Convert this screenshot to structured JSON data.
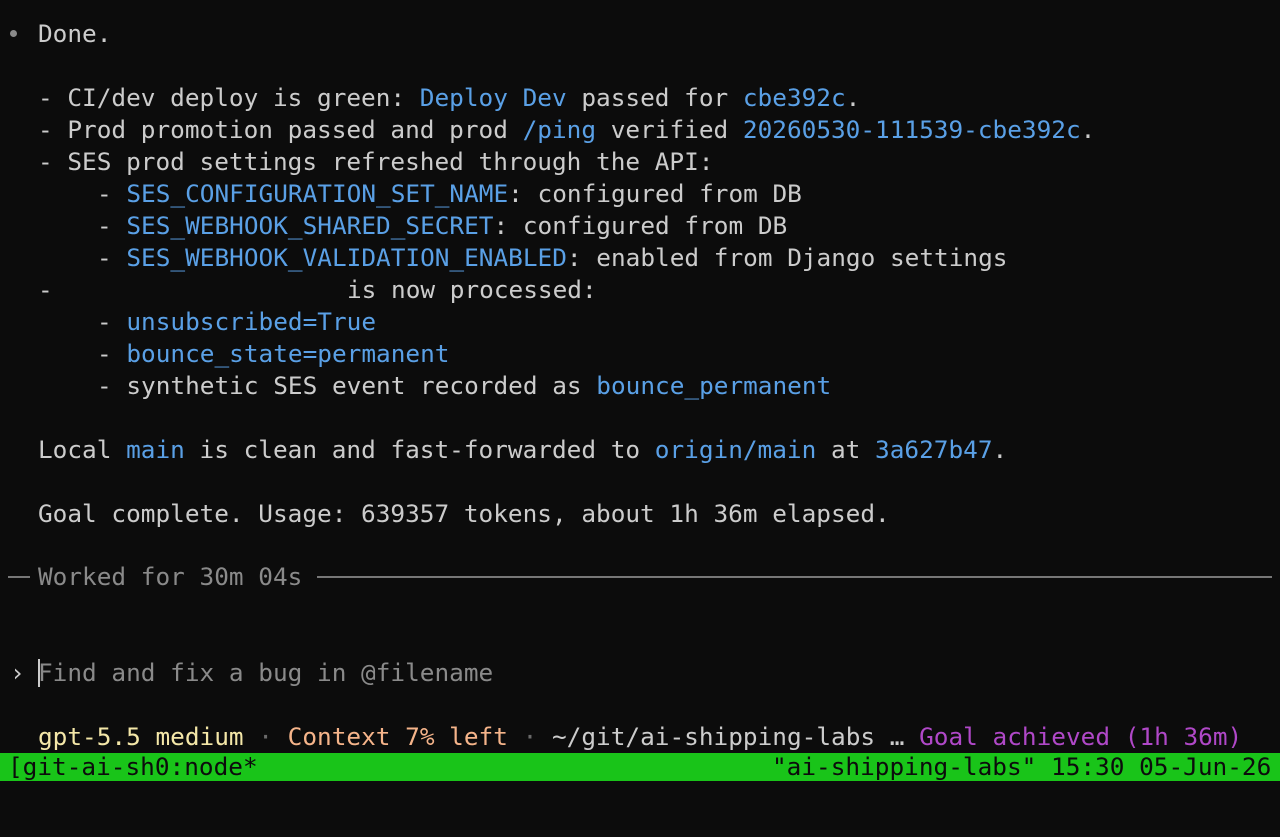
{
  "transcript": {
    "done": "Done.",
    "l1": {
      "pre": "- CI/dev deploy is green: ",
      "h1": "Deploy Dev",
      "mid": " passed for ",
      "h2": "cbe392c",
      "post": "."
    },
    "l2": {
      "pre": "- Prod promotion passed and prod ",
      "h1": "/ping",
      "mid": " verified ",
      "h2": "20260530-111539-cbe392c",
      "post": "."
    },
    "l3": "- SES prod settings refreshed through the API:",
    "l4": {
      "pre": "- ",
      "h": "SES_CONFIGURATION_SET_NAME",
      "post": ": configured from DB"
    },
    "l5": {
      "pre": "- ",
      "h": "SES_WEBHOOK_SHARED_SECRET",
      "post": ": configured from DB"
    },
    "l6": {
      "pre": "- ",
      "h": "SES_WEBHOOK_VALIDATION_ENABLED",
      "post": ": enabled from Django settings"
    },
    "l7a": "-",
    "l7b": "is now processed:",
    "l8": {
      "pre": "- ",
      "h": "unsubscribed=True"
    },
    "l9": {
      "pre": "- ",
      "h": "bounce_state=permanent"
    },
    "l10": {
      "pre": "- synthetic SES event recorded as ",
      "h": "bounce_permanent"
    },
    "l11": {
      "pre": "Local ",
      "h1": "main",
      "mid": " is clean and fast-forwarded to ",
      "h2": "origin/main",
      "mid2": " at ",
      "h3": "3a627b47",
      "post": "."
    },
    "l12": "Goal complete. Usage: 639357 tokens, about 1h 36m elapsed.",
    "worked": "Worked for 30m 04s"
  },
  "prompt": {
    "chevron": "›",
    "placeholder": "Find and fix a bug in @filename"
  },
  "footer": {
    "model": "gpt-5.5 medium",
    "sep1": " · ",
    "context": "Context 7% left",
    "sep2": " · ",
    "path": "~/git/ai-shipping-labs …",
    "goal": "Goal achieved (1h 36m)"
  },
  "statusbar": {
    "left": "[git-ai-sh0:node*",
    "right": "\"ai-shipping-labs\" 15:30 05-Jun-26"
  },
  "colors": {
    "background": "#0c0c0c",
    "highlight": "#5aa0e6",
    "statusbar": "#19c419",
    "goal": "#b048c8",
    "model": "#f4e7a8",
    "context": "#f5b48a"
  }
}
